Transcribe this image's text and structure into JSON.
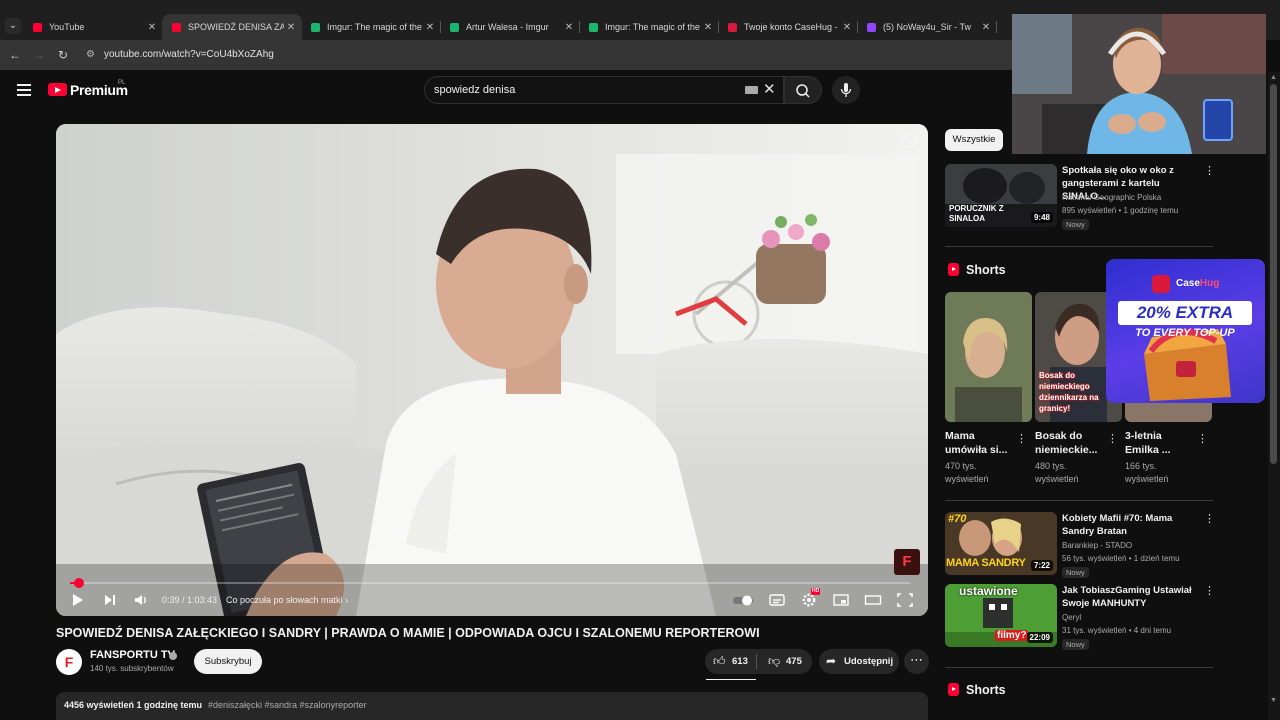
{
  "browser": {
    "tabs": [
      {
        "title": "YouTube",
        "favicon_color": "#ff0033",
        "active": false
      },
      {
        "title": "SPOWIEDŹ DENISA ZAŁ",
        "favicon_color": "#ff0033",
        "active": true
      },
      {
        "title": "Imgur: The magic of the I",
        "favicon_color": "#1bb76e",
        "active": false
      },
      {
        "title": "Artur Walesa - Imgur",
        "favicon_color": "#1bb76e",
        "active": false
      },
      {
        "title": "Imgur: The magic of the I",
        "favicon_color": "#1bb76e",
        "active": false
      },
      {
        "title": "Twoje konto CaseHug - ",
        "favicon_color": "#d9183a",
        "active": false
      },
      {
        "title": "(5) NoWay4u_Sir - Tw",
        "favicon_color": "#9146ff",
        "active": false
      }
    ],
    "url": "youtube.com/watch?v=CoU4bXoZAhg"
  },
  "header": {
    "logo_text": "Premium",
    "country": "PL",
    "search_value": "spowiedz denisa"
  },
  "player": {
    "progress_fraction": 0.0102,
    "time": "0:39 / 1:03:43",
    "chapter": "Co poczuła po słowach matki",
    "chapter_arrow": "›",
    "info_glyph": "i",
    "watermark_glyph": "F",
    "hd_badge": "HD"
  },
  "video": {
    "title": "SPOWIEDŹ DENISA ZAŁĘCKIEGO I SANDRY | PRAWDA O MAMIE | ODPOWIADA OJCU I SZALONEMU REPORTEROWI",
    "channel": "FANSPORTU TV",
    "channel_avatar_glyph": "F",
    "subscribers": "140 tys. subskrybentów",
    "subscribe_label": "Subskrybuj",
    "likes": "613",
    "dislikes": "475",
    "share_label": "Udostępnij",
    "description_meta": "4456 wyświetleń  1 godzinę temu",
    "description_tags": "#deniszałęcki #sandra #szalonyreporter"
  },
  "sidebar": {
    "chip": "Wszystkie",
    "top_video": {
      "title": "Spotkała się oko w oko z gangsterami z kartelu SINALO...",
      "channel": "National Geographic Polska",
      "meta": "895 wyświetleń • 1 godzinę temu",
      "badge": "Nowy",
      "duration": "9:48",
      "thumb_text": "PORUCZNIK Z SINALOA"
    },
    "shorts_heading": "Shorts",
    "shorts": [
      {
        "title": "Mama umówiła si...",
        "views": "470 tys. wyświetleń",
        "thumb_text": ""
      },
      {
        "title": "Bosak do niemieckie...",
        "views": "480 tys. wyświetleń",
        "thumb_text": "Bosak do niemieckiego dziennikarza na granicy!"
      },
      {
        "title": "3-letnia Emilka ...",
        "views": "166 tys. wyświetleń",
        "thumb_text": ""
      }
    ],
    "videos": [
      {
        "title": "Kobiety Mafii #70: Mama Sandry Bratan",
        "channel": "Barankiep - STADO",
        "meta": "56 tys. wyświetleń • 1 dzień temu",
        "badge": "Nowy",
        "duration": "7:22",
        "thumb_text_top": "#70",
        "thumb_text_bottom": "MAMA SANDRY"
      },
      {
        "title": "Jak TobiaszGaming Ustawiał Swoje MANHUNTY",
        "channel": "Qeryl",
        "meta": "31 tys. wyświetleń • 4 dni temu",
        "badge": "Nowy",
        "duration": "22:09",
        "thumb_text_top": "ustawione",
        "thumb_text_bottom": "filmy?"
      }
    ],
    "shorts_heading_2": "Shorts"
  },
  "ad": {
    "brand_a": "Case",
    "brand_b": "Hug",
    "line1": "20% EXTRA",
    "line2": "TO EVERY TOP-UP"
  },
  "colors": {
    "accent": "#ff0033",
    "background": "#0f0f0f",
    "chip": "#272727"
  }
}
